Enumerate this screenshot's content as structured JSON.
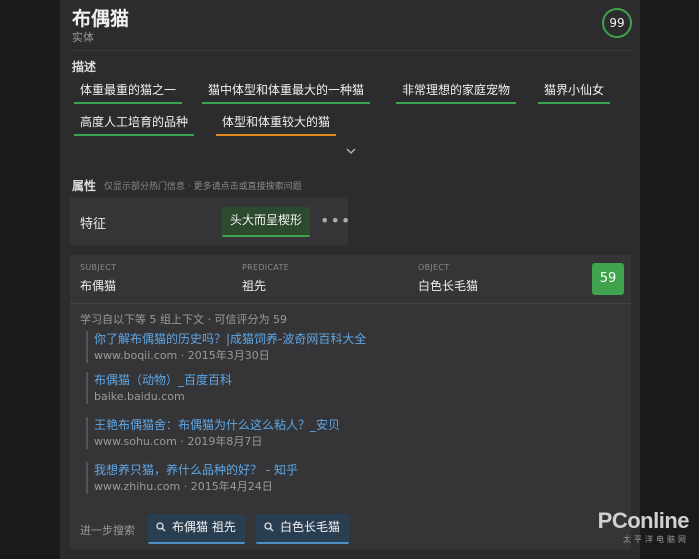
{
  "entity": {
    "title": "布偶猫",
    "type": "实体",
    "score": "99"
  },
  "description": {
    "label": "描述",
    "tags": [
      "体重最重的猫之一",
      "猫中体型和体重最大的一种猫",
      "非常理想的家庭宠物",
      "猫界小仙女",
      "高度人工培育的品种",
      "体型和体重较大的猫"
    ]
  },
  "attributes": {
    "label": "属性",
    "hint": "仅显示部分热门信息 · 更多请点击或直接搜索问题",
    "items": [
      {
        "key": "特征",
        "value": "头大而呈楔形"
      }
    ]
  },
  "triple": {
    "subject_label": "SUBJECT",
    "subject": "布偶猫",
    "predicate_label": "PREDICATE",
    "predicate": "祖先",
    "object_label": "OBJECT",
    "object": "白色长毛猫",
    "score": "59",
    "learned_text": "学习自以下等 5 组上下文 · 可信评分为 59",
    "sources": [
      {
        "title": "你了解布偶猫的历史吗？|成猫饲养-波奇网百科大全",
        "meta": "www.boqii.com · 2015年3月30日"
      },
      {
        "title": "布偶猫（动物）_百度百科",
        "meta": "baike.baidu.com"
      },
      {
        "title": "王艳布偶猫舍：布偶猫为什么这么粘人？_安贝",
        "meta": "www.sohu.com · 2019年8月7日"
      },
      {
        "title": "我想养只猫，养什么品种的好？ - 知乎",
        "meta": "www.zhihu.com · 2015年4月24日"
      }
    ],
    "further_label": "进一步搜索",
    "searches": [
      "布偶猫 祖先",
      "白色长毛猫"
    ]
  },
  "watermark": {
    "logo": "PConline",
    "sub": "太平洋电脑网"
  },
  "colors": {
    "accent_green": "#3fa34d",
    "accent_orange": "#e08a1e",
    "link_blue": "#5ea6e6"
  },
  "icons": [
    "chevron-down-icon",
    "more-icon",
    "search-icon"
  ]
}
